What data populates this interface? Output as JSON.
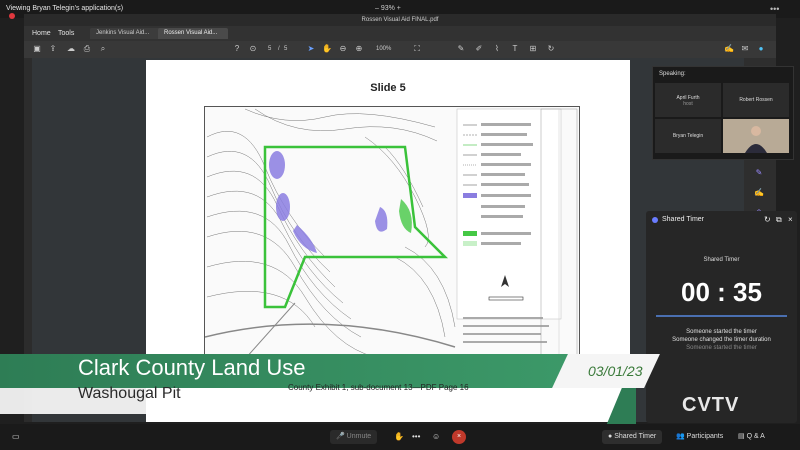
{
  "zoom": {
    "viewing_label": "Viewing Bryan Telegin's application(s)",
    "zoom_level": "93%",
    "more": "•••",
    "shared_timer_button": "Shared Timer",
    "participants_button": "Participants",
    "qa_button": "Q & A",
    "unmute_button": "Unmute"
  },
  "pdf_app": {
    "window_title": "Rossen Visual Aid FINAL.pdf",
    "menu": [
      "Home",
      "Tools"
    ],
    "tabs": [
      "Jenkins Visual Aid...",
      "Rossen Visual Aid..."
    ],
    "page_current": "5",
    "page_sep": "/",
    "page_total": "5",
    "zoom": "100%"
  },
  "document": {
    "slide_title": "Slide 5"
  },
  "speaking": {
    "header": "Speaking:",
    "participants": [
      {
        "name": "April Furth",
        "sub": "host"
      },
      {
        "name": "Robert Rossen",
        "sub": ""
      },
      {
        "name": "Bryan Telegin",
        "sub": ""
      }
    ]
  },
  "timer": {
    "title": "Shared Timer",
    "label": "Shared Timer",
    "value": "00 : 35",
    "messages": [
      "Someone started the timer",
      "Someone changed the timer duration",
      "Someone started the timer"
    ]
  },
  "lower_third": {
    "title": "Clark County Land Use",
    "subtitle": "Washougal Pit",
    "date": "03/01/23",
    "caption": "County Exhibit 1, sub-document 13—PDF Page 16"
  },
  "watermark": "CVTV",
  "colors": {
    "lower_third_green": "#2e7d55",
    "timer_accent": "#4a6fb0",
    "record_red": "#e0383e"
  }
}
